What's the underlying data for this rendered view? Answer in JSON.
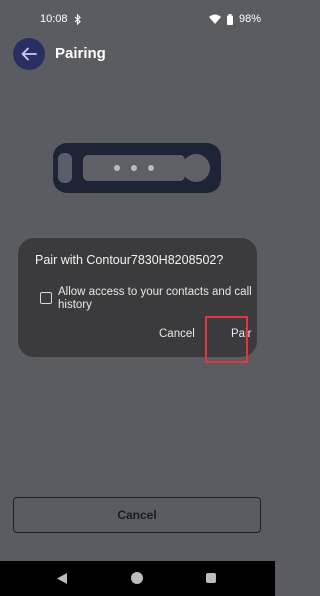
{
  "status": {
    "time": "10:08",
    "battery": "98%",
    "icons": [
      "bluetooth-icon",
      "wifi-icon",
      "battery-icon"
    ]
  },
  "header": {
    "title": "Pairing",
    "back_icon": "arrow-left-icon"
  },
  "dialog": {
    "title": "Pair with Contour7830H8208502?",
    "checkbox_label": "Allow access to your contacts and call history",
    "checkbox_checked": false,
    "cancel_label": "Cancel",
    "pair_label": "Pair"
  },
  "footer": {
    "cancel_label": "Cancel"
  },
  "colors": {
    "background": "#5b5c61",
    "dialog": "#3b3b3d",
    "back_button": "#2a2f63",
    "highlight": "#e3353d"
  }
}
